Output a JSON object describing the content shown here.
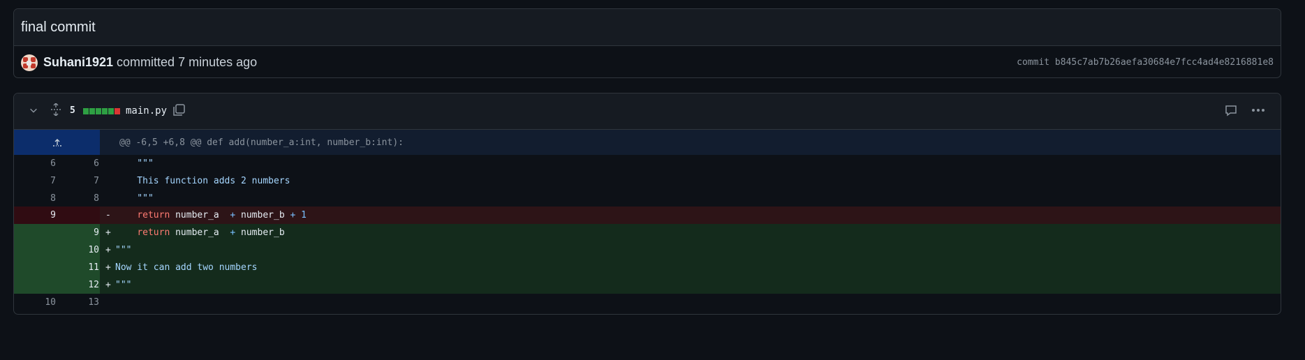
{
  "commit": {
    "title": "final commit",
    "author": "Suhani1921",
    "action": "committed 7 minutes ago",
    "sha_label": "commit b845c7ab7b26aefa30684e7fcc4ad4e8216881e8"
  },
  "file": {
    "changes": "5",
    "name": "main.py",
    "diffstat_colors": [
      "#2ea043",
      "#2ea043",
      "#2ea043",
      "#2ea043",
      "#2ea043",
      "#da3633"
    ],
    "icons": {
      "collapse": "chevron-down-icon",
      "expand_all": "unfold-icon",
      "copy": "copy-icon",
      "comment": "comment-icon",
      "more": "kebab-icon",
      "expand_up": "expand-up-icon"
    }
  },
  "diff": {
    "hunk_header": "@@ -6,5 +6,8 @@ def add(number_a:int, number_b:int):",
    "lines": [
      {
        "old": "6",
        "new": "6",
        "marker": "",
        "type": "ctx",
        "parts": [
          {
            "t": "    \"\"\"",
            "c": "str"
          }
        ]
      },
      {
        "old": "7",
        "new": "7",
        "marker": "",
        "type": "ctx",
        "parts": [
          {
            "t": "    This function adds 2 numbers",
            "c": "str"
          }
        ]
      },
      {
        "old": "8",
        "new": "8",
        "marker": "",
        "type": "ctx",
        "parts": [
          {
            "t": "    \"\"\"",
            "c": "str"
          }
        ]
      },
      {
        "old": "9",
        "new": "",
        "marker": "-",
        "type": "del",
        "parts": [
          {
            "t": "    ",
            "c": ""
          },
          {
            "t": "return",
            "c": "kw"
          },
          {
            "t": " number_a  ",
            "c": ""
          },
          {
            "t": "+",
            "c": "op"
          },
          {
            "t": " number_b ",
            "c": ""
          },
          {
            "t": "+ 1",
            "c": "op"
          }
        ]
      },
      {
        "old": "",
        "new": "9",
        "marker": "+",
        "type": "add",
        "parts": [
          {
            "t": "    ",
            "c": ""
          },
          {
            "t": "return",
            "c": "kw"
          },
          {
            "t": " number_a  ",
            "c": ""
          },
          {
            "t": "+",
            "c": "op"
          },
          {
            "t": " number_b",
            "c": ""
          }
        ]
      },
      {
        "old": "",
        "new": "10",
        "marker": "+",
        "type": "add",
        "parts": [
          {
            "t": "\"\"\"",
            "c": "str"
          }
        ]
      },
      {
        "old": "",
        "new": "11",
        "marker": "+",
        "type": "add",
        "parts": [
          {
            "t": "Now it can add two numbers",
            "c": "str"
          }
        ]
      },
      {
        "old": "",
        "new": "12",
        "marker": "+",
        "type": "add",
        "parts": [
          {
            "t": "\"\"\"",
            "c": "str"
          }
        ]
      },
      {
        "old": "10",
        "new": "13",
        "marker": "",
        "type": "ctx",
        "parts": []
      }
    ]
  }
}
